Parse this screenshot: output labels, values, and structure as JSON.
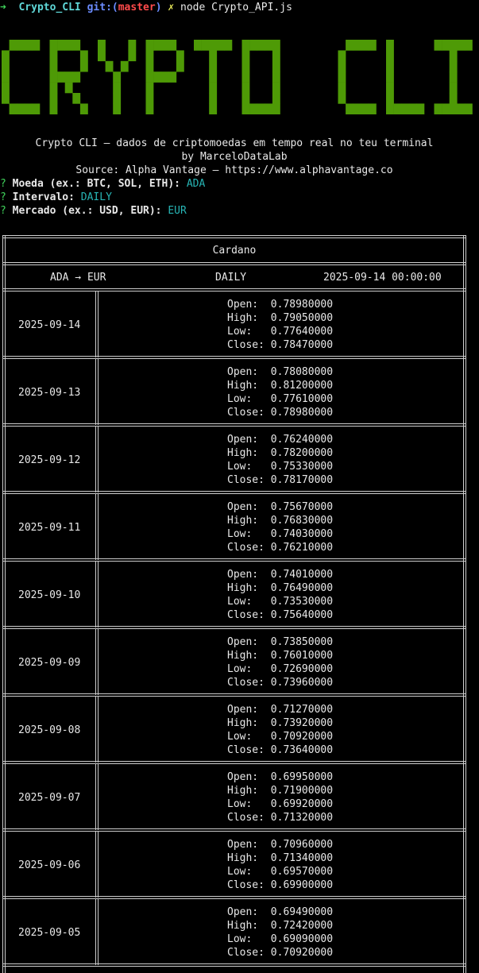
{
  "prompt": {
    "arrow": "➜",
    "directory": "Crypto_CLI",
    "git_label": "git:(",
    "branch": "master",
    "git_close": ")",
    "dirty_mark": "✗",
    "command": "node Crypto_API.js"
  },
  "banner": {
    "text": "CRYPTO CLI",
    "color": "#4e9a06"
  },
  "intro": {
    "tagline": "Crypto CLI — dados de criptomoedas em tempo real no teu terminal",
    "author": "by MarceloDataLab",
    "source": "Source: Alpha Vantage — https://www.alphavantage.co"
  },
  "questions": [
    {
      "mark": "?",
      "label": "Moeda (ex.: BTC, SOL, ETH):",
      "answer": "ADA"
    },
    {
      "mark": "?",
      "label": "Intervalo:",
      "answer": "DAILY"
    },
    {
      "mark": "?",
      "label": "Mercado (ex.: USD, EUR):",
      "answer": "EUR"
    }
  ],
  "table": {
    "title": "Cardano",
    "pair": "ADA → EUR",
    "interval": "DAILY",
    "last_refreshed": "2025-09-14 00:00:00",
    "labels": {
      "open": "Open:  ",
      "high": "High:  ",
      "low": "Low:   ",
      "close": "Close: "
    },
    "rows": [
      {
        "date": "2025-09-14",
        "open": "0.78980000",
        "high": "0.79050000",
        "low": "0.77640000",
        "close": "0.78470000"
      },
      {
        "date": "2025-09-13",
        "open": "0.78080000",
        "high": "0.81200000",
        "low": "0.77610000",
        "close": "0.78980000"
      },
      {
        "date": "2025-09-12",
        "open": "0.76240000",
        "high": "0.78200000",
        "low": "0.75330000",
        "close": "0.78170000"
      },
      {
        "date": "2025-09-11",
        "open": "0.75670000",
        "high": "0.76830000",
        "low": "0.74030000",
        "close": "0.76210000"
      },
      {
        "date": "2025-09-10",
        "open": "0.74010000",
        "high": "0.76490000",
        "low": "0.73530000",
        "close": "0.75640000"
      },
      {
        "date": "2025-09-09",
        "open": "0.73850000",
        "high": "0.76010000",
        "low": "0.72690000",
        "close": "0.73960000"
      },
      {
        "date": "2025-09-08",
        "open": "0.71270000",
        "high": "0.73920000",
        "low": "0.70920000",
        "close": "0.73640000"
      },
      {
        "date": "2025-09-07",
        "open": "0.69950000",
        "high": "0.71900000",
        "low": "0.69920000",
        "close": "0.71320000"
      },
      {
        "date": "2025-09-06",
        "open": "0.70960000",
        "high": "0.71340000",
        "low": "0.69570000",
        "close": "0.69900000"
      },
      {
        "date": "2025-09-05",
        "open": "0.69490000",
        "high": "0.72420000",
        "low": "0.69090000",
        "close": "0.70920000"
      }
    ]
  }
}
